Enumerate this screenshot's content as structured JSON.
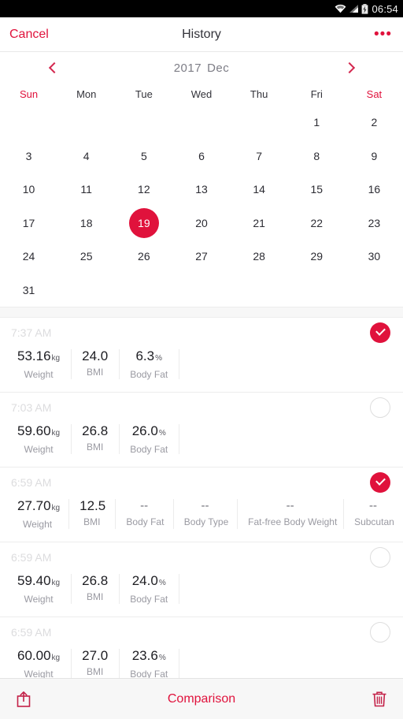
{
  "statusbar": {
    "time": "06:54",
    "icons": [
      "wifi-icon",
      "signal-icon",
      "battery-charging-icon"
    ]
  },
  "navbar": {
    "cancel_label": "Cancel",
    "title": "History",
    "more_label": "•••"
  },
  "calendar": {
    "year": "2017",
    "month": "Dec",
    "prev_icon": "chevron-left-icon",
    "next_icon": "chevron-right-icon",
    "day_names": [
      "Sun",
      "Mon",
      "Tue",
      "Wed",
      "Thu",
      "Fri",
      "Sat"
    ],
    "leading_blanks": 5,
    "days": [
      1,
      2,
      3,
      4,
      5,
      6,
      7,
      8,
      9,
      10,
      11,
      12,
      13,
      14,
      15,
      16,
      17,
      18,
      19,
      20,
      21,
      22,
      23,
      24,
      25,
      26,
      27,
      28,
      29,
      30,
      31
    ],
    "selected_day": 19,
    "accent_color": "#e0123c"
  },
  "records": [
    {
      "time": "7:37 AM",
      "selected": true,
      "metrics": [
        {
          "value": "53.16",
          "unit": "kg",
          "label": "Weight"
        },
        {
          "value": "24.0",
          "unit": "",
          "label": "BMI"
        },
        {
          "value": "6.3",
          "unit": "%",
          "label": "Body Fat"
        }
      ]
    },
    {
      "time": "7:03 AM",
      "selected": false,
      "metrics": [
        {
          "value": "59.60",
          "unit": "kg",
          "label": "Weight"
        },
        {
          "value": "26.8",
          "unit": "",
          "label": "BMI"
        },
        {
          "value": "26.0",
          "unit": "%",
          "label": "Body Fat"
        }
      ]
    },
    {
      "time": "6:59 AM",
      "selected": true,
      "metrics": [
        {
          "value": "27.70",
          "unit": "kg",
          "label": "Weight"
        },
        {
          "value": "12.5",
          "unit": "",
          "label": "BMI"
        },
        {
          "value": "--",
          "unit": "",
          "label": "Body Fat"
        },
        {
          "value": "--",
          "unit": "",
          "label": "Body Type"
        },
        {
          "value": "--",
          "unit": "",
          "label": "Fat-free Body Weight"
        },
        {
          "value": "--",
          "unit": "",
          "label": "Subcutan"
        }
      ]
    },
    {
      "time": "6:59 AM",
      "selected": false,
      "metrics": [
        {
          "value": "59.40",
          "unit": "kg",
          "label": "Weight"
        },
        {
          "value": "26.8",
          "unit": "",
          "label": "BMI"
        },
        {
          "value": "24.0",
          "unit": "%",
          "label": "Body Fat"
        }
      ]
    },
    {
      "time": "6:59 AM",
      "selected": false,
      "metrics": [
        {
          "value": "60.00",
          "unit": "kg",
          "label": "Weight"
        },
        {
          "value": "27.0",
          "unit": "",
          "label": "BMI"
        },
        {
          "value": "23.6",
          "unit": "%",
          "label": "Body Fat"
        }
      ]
    }
  ],
  "bottombar": {
    "share_icon": "share-icon",
    "comparison_label": "Comparison",
    "delete_icon": "trash-icon"
  }
}
